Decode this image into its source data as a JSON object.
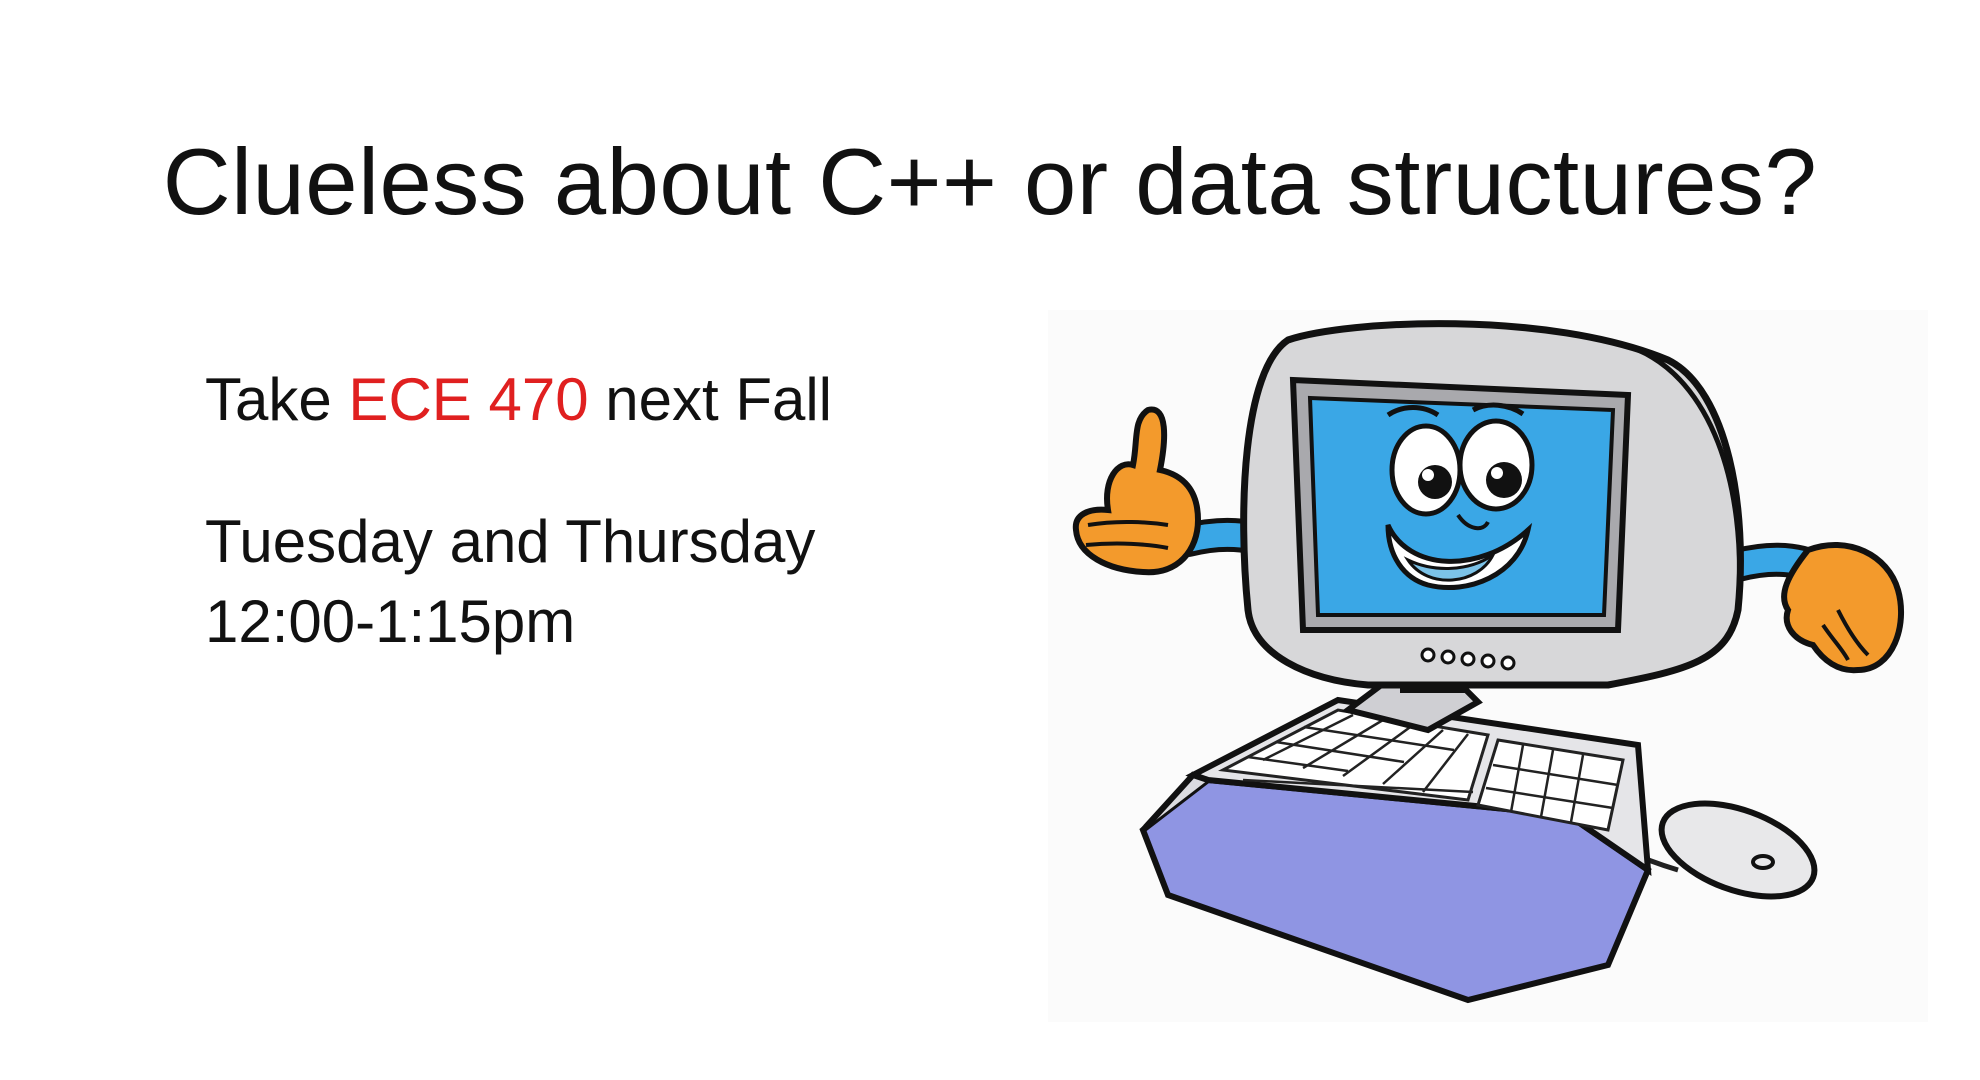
{
  "slide": {
    "title": "Clueless about C++ or data structures?",
    "line1": {
      "prefix": "Take ",
      "highlight": "ECE 470",
      "suffix": " next Fall"
    },
    "schedule_days": "Tuesday and Thursday",
    "schedule_time": "12:00-1:15pm"
  },
  "colors": {
    "highlight": "#e02020",
    "screen": "#3aa7e6",
    "glove": "#f39a2c",
    "monitor": "#d7d7d9",
    "keyboard_base": "#8f95e3"
  },
  "clipart": {
    "icon": "computer-mascot-thumbs-up-icon"
  }
}
